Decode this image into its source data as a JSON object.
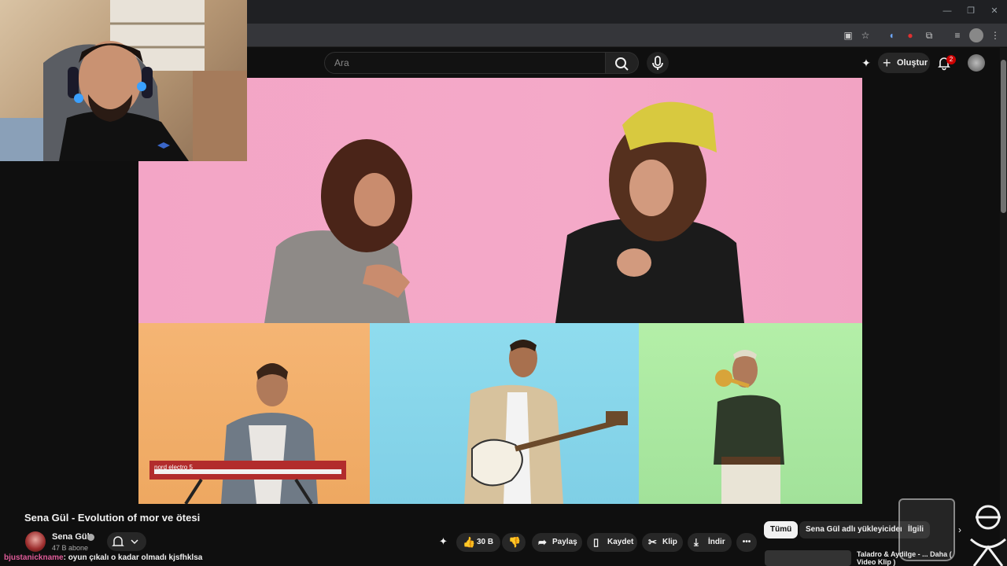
{
  "youtube": {
    "search_placeholder": "Ara",
    "create_label": "Oluştur",
    "notification_count": "2"
  },
  "video": {
    "title": "Sena Gül - Evolution of mor ve ötesi",
    "keyboard_brand": "nord electro 5"
  },
  "channel": {
    "name": "Sena Gül",
    "subscribers": "47 B abone"
  },
  "actions": {
    "likes": "30 B",
    "share": "Paylaş",
    "save": "Kaydet",
    "clip": "Klip",
    "download": "İndir"
  },
  "chat": {
    "user": "bjustanickname",
    "message": ": oyun çıkalı o kadar olmadı kjsfhklsa"
  },
  "chips": {
    "all": "Tümü",
    "uploader": "Sena Gül adlı yükleyiciden",
    "related": "İlgili"
  },
  "recommended": {
    "title": "Taladro & Aydilge - ... Daha ( Video Klip )"
  },
  "colors": {
    "accent_red": "#cc0000",
    "panel_pink": "#f3a5c6",
    "panel_orange": "#f5b574",
    "panel_blue": "#8fdcee",
    "panel_green": "#b4efa8"
  }
}
